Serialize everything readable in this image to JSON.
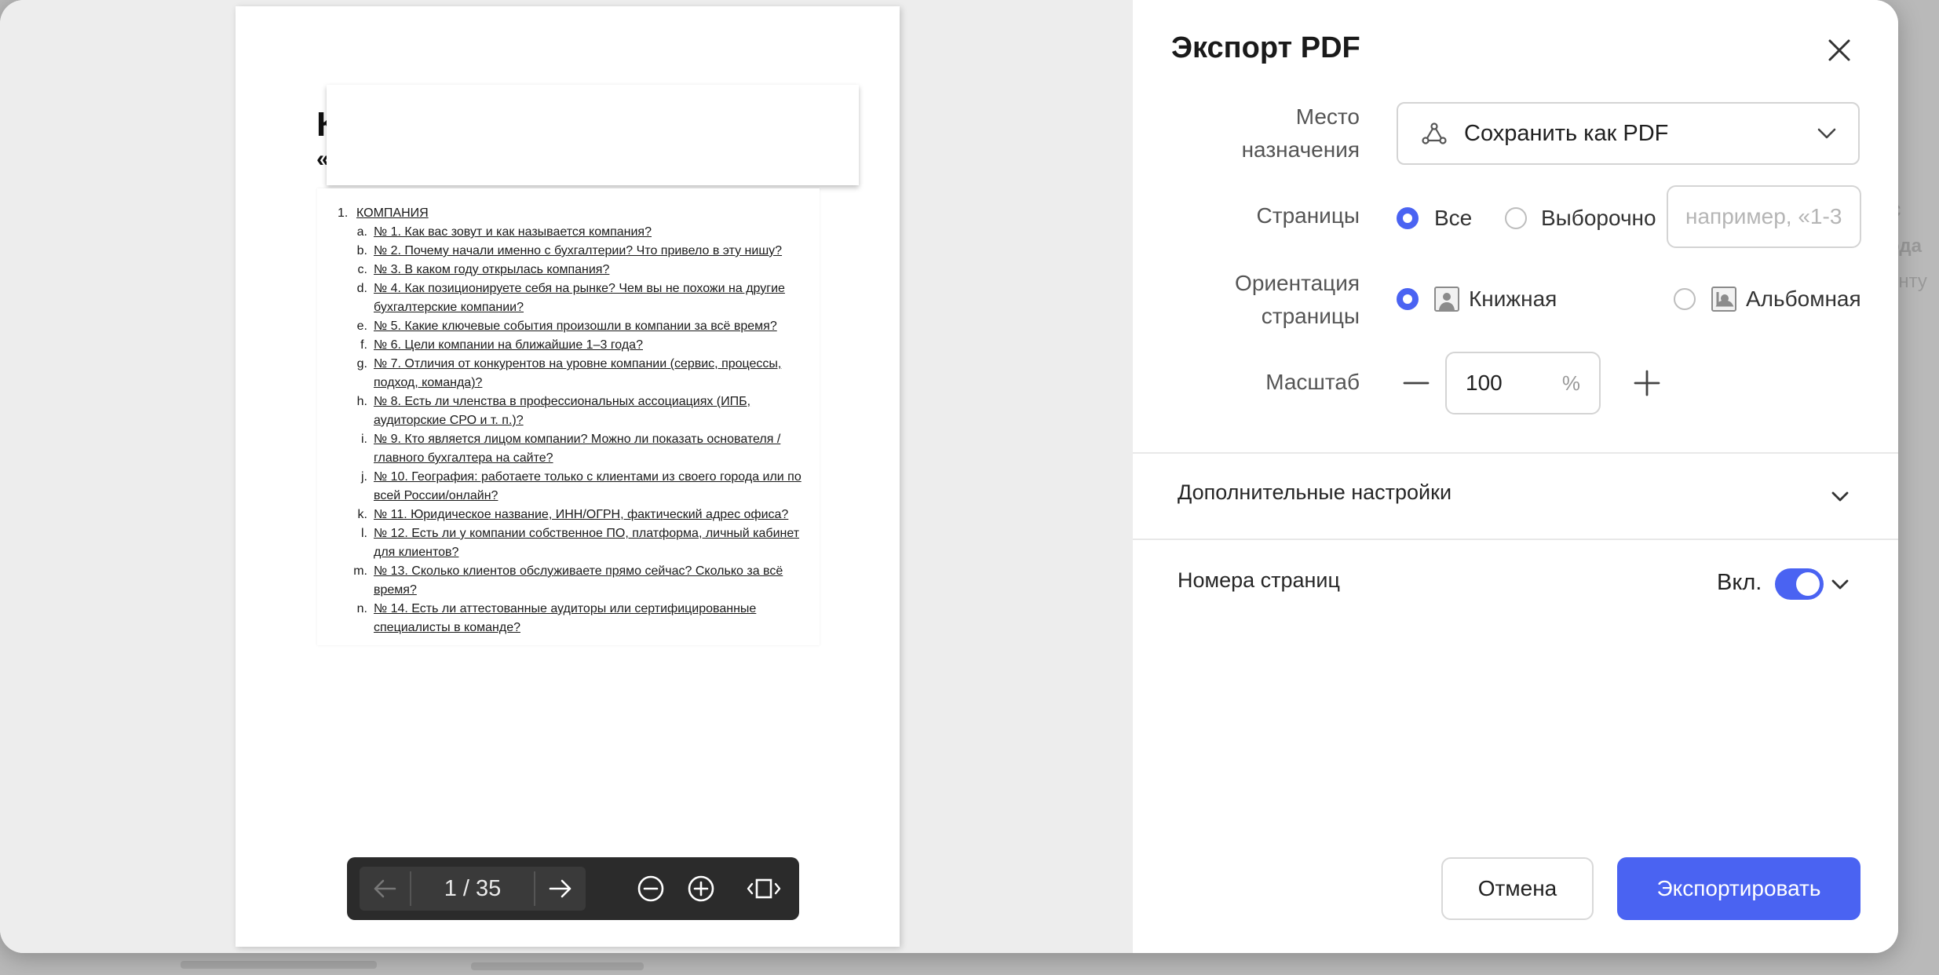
{
  "dialog": {
    "title": "Экспорт PDF",
    "close_icon": "close-icon"
  },
  "destination": {
    "label_line1": "Место",
    "label_line2": "назначения",
    "value": "Сохранить как PDF",
    "icon": "pdf-acrobat-icon"
  },
  "pages": {
    "label": "Страницы",
    "options": [
      "Все",
      "Выборочно"
    ],
    "selected": "Все",
    "range_placeholder": "например, «1-3"
  },
  "orientation": {
    "label_line1": "Ориентация",
    "label_line2": "страницы",
    "options": [
      "Книжная",
      "Альбомная"
    ],
    "selected": "Книжная"
  },
  "scale": {
    "label": "Масштаб",
    "value": "100",
    "unit": "%"
  },
  "advanced": {
    "label": "Дополнительные настройки"
  },
  "page_numbers": {
    "label": "Номера страниц",
    "state_label": "Вкл.",
    "enabled": true
  },
  "buttons": {
    "cancel": "Отмена",
    "export": "Экспортировать"
  },
  "pager": {
    "counter": "1 / 35"
  },
  "document": {
    "heading_fragment": "К",
    "subheading_fragment": "«",
    "toc": {
      "number": "1.",
      "title": "КОМПАНИЯ",
      "items": [
        {
          "letter": "a.",
          "text": "№ 1. Как вас зовут и как называется компания?"
        },
        {
          "letter": "b.",
          "text": "№ 2. Почему начали именно с бухгалтерии? Что привело в эту нишу?"
        },
        {
          "letter": "c.",
          "text": "№ 3. В каком году открылась компания?"
        },
        {
          "letter": "d.",
          "text": "№ 4. Как позиционируете себя на рынке? Чем вы не похожи на другие бухгалтерские компании?"
        },
        {
          "letter": "e.",
          "text": "№ 5. Какие ключевые события произошли в компании за всё время?"
        },
        {
          "letter": "f.",
          "text": "№ 6. Цели компании на ближайшие 1–3 года?"
        },
        {
          "letter": "g.",
          "text": "№ 7. Отличия от конкурентов на уровне компании (сервис, процессы, подход, команда)?"
        },
        {
          "letter": "h.",
          "text": "№ 8. Есть ли членства в профессиональных ассоциациях (ИПБ, аудиторские СРО и т. п.)?"
        },
        {
          "letter": "i.",
          "text": "№ 9. Кто является лицом компании? Можно ли показать основателя / главного бухгалтера на сайте?"
        },
        {
          "letter": "j.",
          "text": "№ 10. География: работаете только с клиентами из своего города или по всей России/онлайн?"
        },
        {
          "letter": "k.",
          "text": "№ 11. Юридическое название, ИНН/ОГРН, фактический адрес офиса?"
        },
        {
          "letter": "l.",
          "text": "№ 12. Есть ли у компании собственное ПО, платформа, личный кабинет для клиентов?"
        },
        {
          "letter": "m.",
          "text": "№ 13. Сколько клиентов обслуживаете прямо сейчас? Сколько за всё время?"
        },
        {
          "letter": "n.",
          "text": "№ 14. Есть ли аттестованные аудиторы или сертифицированные специалисты в команде?"
        }
      ]
    }
  },
  "background": {
    "right_snippet_1": "с",
    "right_snippet_2": "ода",
    "right_snippet_3": "енту"
  },
  "colors": {
    "accent": "#4a63f2",
    "pager_bg": "#2b2b2b"
  }
}
